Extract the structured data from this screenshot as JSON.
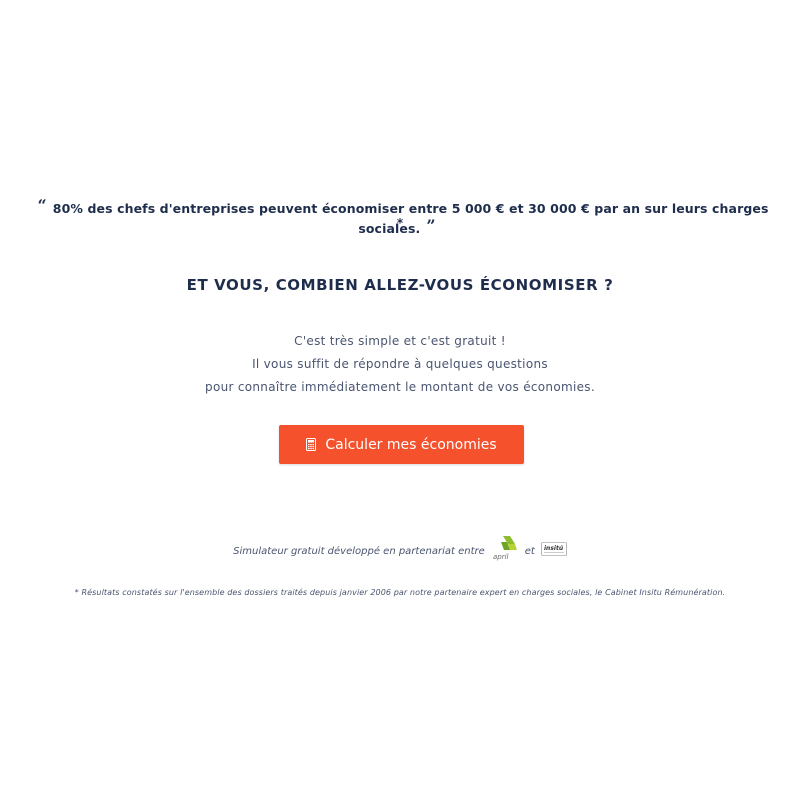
{
  "quote": {
    "open_mark": "“",
    "text": "80% des chefs d'entreprises peuvent économiser entre 5 000 € et 30 000 € par an sur leurs charges sociales.",
    "close_mark": "”",
    "trailing_mark": "*"
  },
  "headline": "ET VOUS, COMBIEN ALLEZ-VOUS ÉCONOMISER ?",
  "intro": {
    "line1": "C'est très simple et c'est gratuit !",
    "line2": "Il vous suffit de répondre à quelques questions",
    "line3": "pour connaître immédiatement le montant de vos économies."
  },
  "cta": {
    "label": "Calculer mes économies",
    "icon": "calculator-icon",
    "color": "#f4512c"
  },
  "partners": {
    "prefix": "Simulateur gratuit développé en partenariat entre",
    "connector": "et",
    "logo1_text": "april",
    "logo2_text": "insitú"
  },
  "footnote": "* Résultats constatés sur l'ensemble des dossiers traités depuis janvier 2006 par notre partenaire expert en charges sociales, le Cabinet Insitu Rémunération.",
  "colors": {
    "navy": "#1f2d4d",
    "body_text": "#4a5570",
    "accent": "#f4512c",
    "april_green": "#8dbd2c"
  }
}
